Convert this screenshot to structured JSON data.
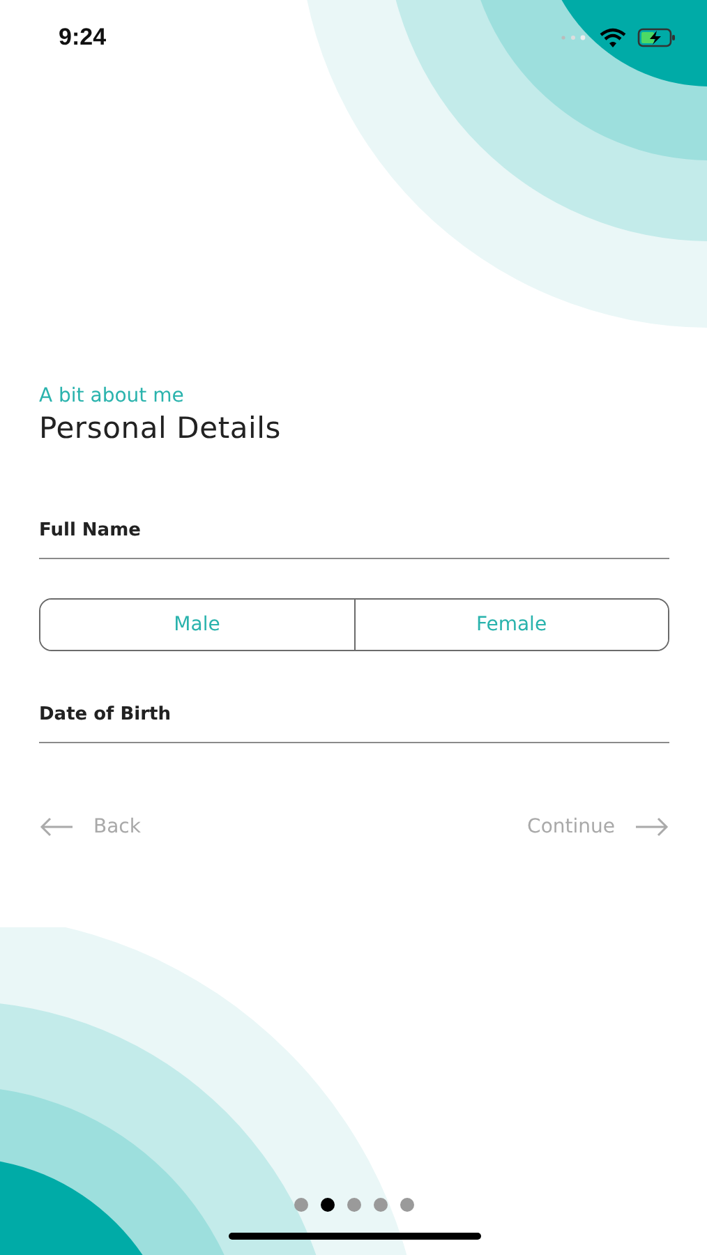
{
  "status_bar": {
    "time": "9:24"
  },
  "header": {
    "eyebrow": "A bit about me",
    "title": "Personal Details"
  },
  "fields": [
    {
      "label": "Full Name",
      "kind": "text"
    },
    {
      "kind": "segmented",
      "options": [
        {
          "label": "Male",
          "selected": false
        },
        {
          "label": "Female",
          "selected": false
        }
      ]
    },
    {
      "label": "Date of Birth",
      "kind": "text"
    }
  ],
  "nav": {
    "back": "Back",
    "continue": "Continue"
  },
  "page_dots": [
    {
      "selected": false
    },
    {
      "selected": true
    },
    {
      "selected": false
    },
    {
      "selected": false
    },
    {
      "selected": false
    }
  ]
}
